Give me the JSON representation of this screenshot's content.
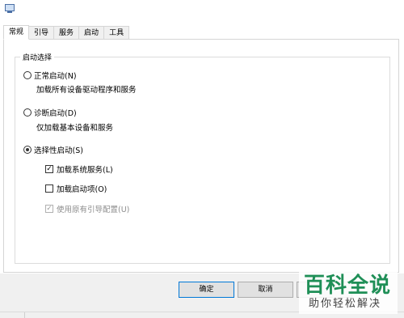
{
  "window": {
    "icon": "system-configuration-icon"
  },
  "tabs": [
    {
      "label": "常规",
      "active": true
    },
    {
      "label": "引导",
      "active": false
    },
    {
      "label": "服务",
      "active": false
    },
    {
      "label": "启动",
      "active": false
    },
    {
      "label": "工具",
      "active": false
    }
  ],
  "startup_selection": {
    "legend": "启动选择",
    "normal": {
      "label": "正常启动(N)",
      "description": "加载所有设备驱动程序和服务",
      "checked": false
    },
    "diagnostic": {
      "label": "诊断启动(D)",
      "description": "仅加载基本设备和服务",
      "checked": false
    },
    "selective": {
      "label": "选择性启动(S)",
      "checked": true,
      "load_services": {
        "label": "加载系统服务(L)",
        "checked": true
      },
      "load_startup": {
        "label": "加载启动项(O)",
        "checked": false
      },
      "use_original_boot": {
        "label": "使用原有引导配置(U)",
        "checked": true,
        "disabled": true
      }
    }
  },
  "footer": {
    "ok_label": "确定",
    "cancel_label": "取消"
  },
  "watermark": {
    "main": "百科全说",
    "sub": "助你轻松解决"
  },
  "colors": {
    "accent": "#0078d7",
    "watermark_green": "#1f8f57"
  }
}
